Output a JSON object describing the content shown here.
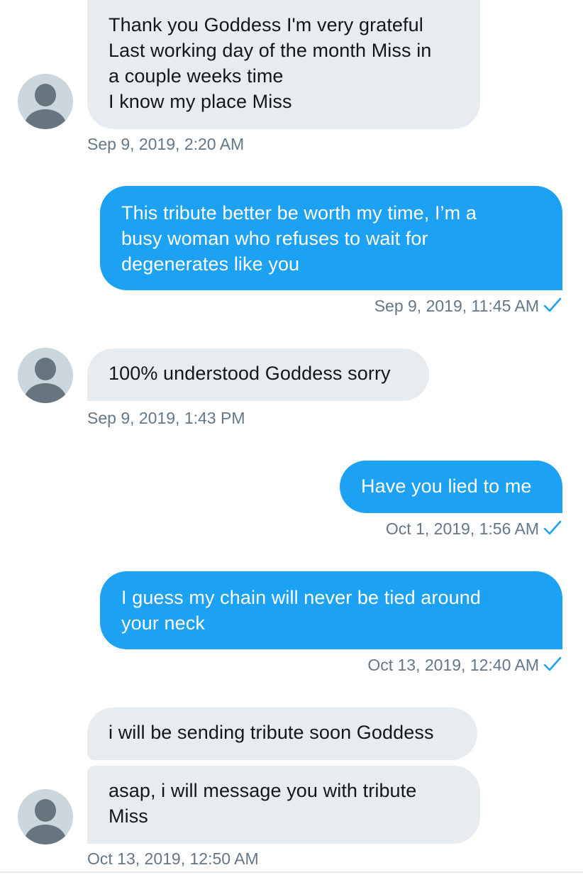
{
  "conversation": {
    "messages": [
      {
        "id": "m1",
        "direction": "received",
        "text": "Thank you Goddess I'm very grateful\nLast working day of the month Miss in\na couple weeks time\nI know my place Miss",
        "timestamp": "Sep 9, 2019, 2:20 AM"
      },
      {
        "id": "m2",
        "direction": "sent",
        "text": "This tribute better be worth my time, I’m a\nbusy woman who refuses to wait for\ndegenerates like you",
        "timestamp": "Sep 9, 2019, 11:45 AM",
        "read_status": "check-icon"
      },
      {
        "id": "m3",
        "direction": "received",
        "text": "100% understood Goddess sorry",
        "timestamp": "Sep 9, 2019, 1:43 PM"
      },
      {
        "id": "m4",
        "direction": "sent",
        "text": "Have you lied to me",
        "timestamp": "Oct 1, 2019, 1:56 AM",
        "read_status": "check-icon"
      },
      {
        "id": "m5",
        "direction": "sent",
        "text": "I guess my chain will never be tied around\nyour neck",
        "timestamp": "Oct 13, 2019, 12:40 AM",
        "read_status": "check-icon"
      },
      {
        "id": "m6",
        "direction": "received",
        "text": "i will be sending tribute soon Goddess"
      },
      {
        "id": "m7",
        "direction": "received",
        "text": "asap, i will message you with tribute\nMiss",
        "timestamp": "Oct 13, 2019, 12:50 AM"
      }
    ]
  },
  "theme": {
    "sent_bubble": "#1da1f2",
    "received_bubble": "#e6ecf0",
    "timestamp_text": "#657786",
    "avatar_bg": "#ccd6dd",
    "avatar_fg": "#66757f"
  },
  "icons": {
    "avatar": "default-profile-icon",
    "read_receipt": "check-icon"
  }
}
